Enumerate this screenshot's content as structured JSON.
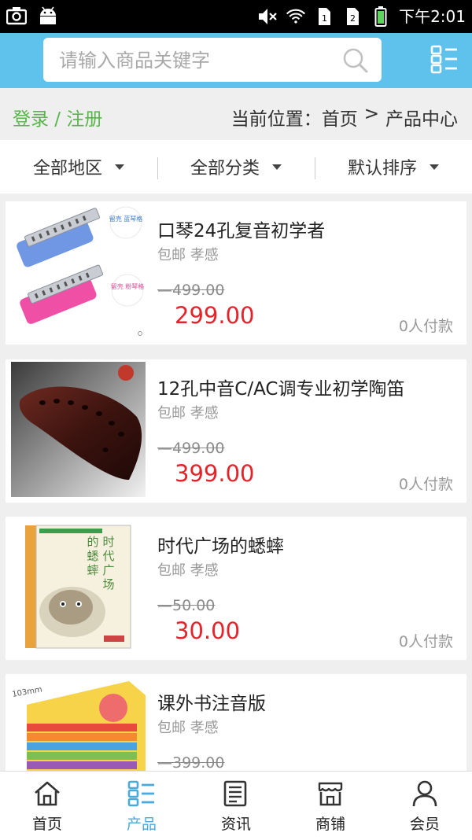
{
  "status_bar": {
    "time": "下午2:01"
  },
  "header": {
    "search_placeholder": "请输入商品关键字"
  },
  "breadcrumb": {
    "login": "登录 / 注册",
    "label": "当前位置：",
    "home": "首页",
    "separator": ">",
    "current": "产品中心"
  },
  "filters": [
    {
      "label": "全部地区"
    },
    {
      "label": "全部分类"
    },
    {
      "label": "默认排序"
    }
  ],
  "products": [
    {
      "title": "口琴24孔复音初学者",
      "shipping": "包邮 孝感",
      "original_price": "499.00",
      "price": "299.00",
      "sold": "0人付款"
    },
    {
      "title": "12孔中音C/AC调专业初学陶笛",
      "shipping": "包邮 孝感",
      "original_price": "499.00",
      "price": "399.00",
      "sold": "0人付款"
    },
    {
      "title": "时代广场的蟋蟀",
      "shipping": "包邮 孝感",
      "original_price": "50.00",
      "price": "30.00",
      "sold": "0人付款"
    },
    {
      "title": "课外书注音版",
      "shipping": "包邮 孝感",
      "original_price": "399.00",
      "price": "",
      "sold": ""
    }
  ],
  "thumb_text": {
    "harmonica_badge_1": "留壳 蓝琴格",
    "harmonica_badge_2": "留壳 粉琴格",
    "book_title_chars": [
      "时",
      "代",
      "广",
      "场",
      "的",
      "蟋",
      "蟀"
    ],
    "book_size_label": "103mm"
  },
  "tabs": [
    {
      "label": "首页",
      "icon": "home-icon",
      "active": false
    },
    {
      "label": "产品",
      "icon": "product-list-icon",
      "active": true
    },
    {
      "label": "资讯",
      "icon": "news-icon",
      "active": false
    },
    {
      "label": "商铺",
      "icon": "shop-icon",
      "active": false
    },
    {
      "label": "会员",
      "icon": "member-icon",
      "active": false
    }
  ],
  "colors": {
    "header": "#5ec2ec",
    "accent_green": "#58b64a",
    "price_red": "#e5232a",
    "tab_active": "#49aadc"
  }
}
